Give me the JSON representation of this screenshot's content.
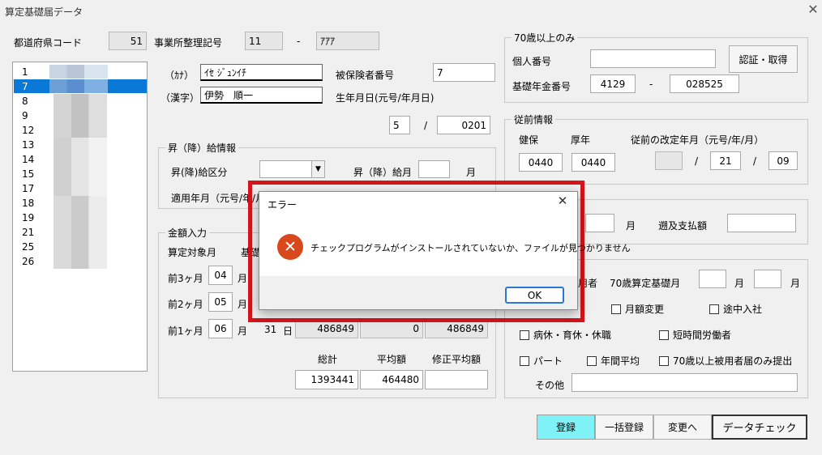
{
  "window": {
    "title": "算定基礎届データ"
  },
  "top": {
    "pref_code_label": "都道府県コード",
    "pref_code": "51",
    "office_code_label": "事業所整理記号",
    "office_code1": "11",
    "office_dash": "-",
    "office_code2": "ｱｱｱ"
  },
  "list": {
    "items": [
      "1",
      "7",
      "8",
      "9",
      "12",
      "13",
      "14",
      "15",
      "17",
      "18",
      "19",
      "21",
      "25",
      "26"
    ],
    "selected_index": 1
  },
  "person": {
    "kana_label": "（ｶﾅ）",
    "kana_value": "ｲｾ ｼﾞｭﾝｲﾁ",
    "kanji_label": "（漢字）",
    "kanji_value": "伊勢　順一",
    "insured_no_label": "被保険者番号",
    "insured_no": "7",
    "birth_label": "生年月日(元号/年月日)",
    "birth_era": "5",
    "birth_slash": "/",
    "birth_date": "0201"
  },
  "promotion": {
    "title": "昇（降）給情報",
    "type_label": "昇(降)給区分",
    "month_label": "昇（降）給月",
    "month_unit": "月",
    "apply_label": "適用年月（元号/年/月）"
  },
  "amount": {
    "title": "金額入力",
    "target_month_label": "算定対象月",
    "basis_label": "基礎",
    "rows": [
      {
        "label": "前3ヶ月",
        "month": "04",
        "unit": "月"
      },
      {
        "label": "前2ヶ月",
        "month": "05",
        "unit": "月"
      },
      {
        "label": "前1ヶ月",
        "month": "06",
        "unit": "月",
        "days": "31",
        "day_unit": "日",
        "v1": "486849",
        "v2": "0",
        "v3": "486849"
      }
    ],
    "total_label": "総計",
    "avg_label": "平均額",
    "adj_avg_label": "修正平均額",
    "total": "1393441",
    "avg": "464480",
    "adj_avg": ""
  },
  "over70": {
    "title": "70歳以上のみ",
    "personal_no_label": "個人番号",
    "personal_no": "",
    "auth_button": "認証・取得",
    "pension_label": "基礎年金番号",
    "pension1": "4129",
    "pension_dash": "-",
    "pension2": "028525"
  },
  "previous": {
    "title": "従前情報",
    "health_label": "健保",
    "pension_label": "厚年",
    "revision_label": "従前の改定年月（元号/年/月）",
    "health": "0440",
    "pension": "0440",
    "era": "",
    "year": "21",
    "month": "09",
    "slash1": "/",
    "slash2": "/"
  },
  "retro": {
    "month_unit": "月",
    "amount_label": "遡及支払額"
  },
  "remarks": {
    "employee_suffix": "用者",
    "base_month_label": "70歳算定基礎月",
    "unit1": "月",
    "unit2": "月",
    "monthly_change": "月額変更",
    "midway": "途中入社",
    "leave": "病休・育休・休職",
    "short_time": "短時間労働者",
    "part": "パート",
    "annual_avg": "年間平均",
    "over70_only": "70歳以上被用者届のみ提出",
    "other_label": "その他"
  },
  "buttons": {
    "register": "登録",
    "bulk_register": "一括登録",
    "change": "変更へ",
    "data_check": "データチェック"
  },
  "dialog": {
    "title": "エラー",
    "message": "チェックプログラムがインストールされていないか、ファイルが見つかりません",
    "ok": "OK"
  },
  "colors": {
    "selection": "#0a78d7",
    "register_button": "#7ef2f7",
    "highlight_border": "#d6141b",
    "error_icon": "#d9481c"
  }
}
